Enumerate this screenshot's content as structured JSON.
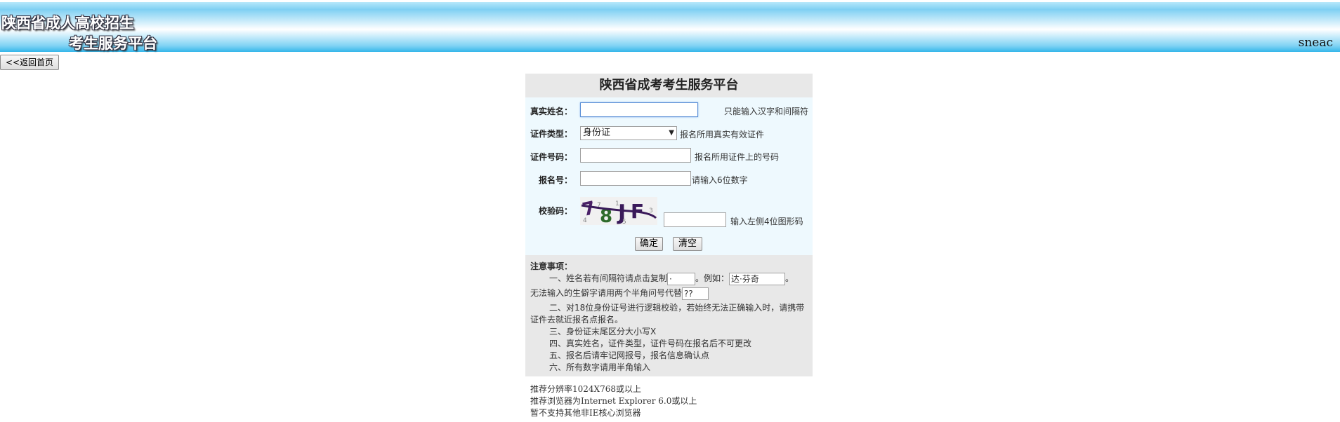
{
  "header": {
    "logo_line1": "陕西省成人高校招生",
    "logo_line2": "考生服务平台",
    "site_tag": "sneac"
  },
  "nav": {
    "back_label": "<<返回首页"
  },
  "panel": {
    "title": "陕西省成考考生服务平台",
    "fields": {
      "name": {
        "label": "真实姓名：",
        "value": "",
        "hint": "只能输入汉字和间隔符"
      },
      "id_type": {
        "label": "证件类型：",
        "selected": "身份证",
        "hint": "报名所用真实有效证件"
      },
      "id_number": {
        "label": "证件号码：",
        "value": "",
        "hint": "报名所用证件上的号码"
      },
      "reg_number": {
        "label": "报名号：",
        "value": "",
        "hint": "请输入6位数字"
      },
      "captcha": {
        "label": "校验码：",
        "value": "",
        "hint": "输入左侧4位图形码",
        "image_text": "78JF"
      }
    },
    "buttons": {
      "confirm": "确定",
      "clear": "清空"
    }
  },
  "notes": {
    "title": "注意事项：",
    "item1_pre": "一、姓名若有间隔符请点击复制",
    "item1_copy_value": "·",
    "item1_mid": "。例如：",
    "item1_example": "达·芬奇",
    "item1_post": "。",
    "item1_line2": "无法输入的生僻字请用两个半角问号代替",
    "item1_placeholder": "??",
    "item2_line1": "二、对18位身份证号进行逻辑校验，若始终无法正确输入时，请携带",
    "item2_line2": "证件去就近报名点报名。",
    "item3": "三、身份证末尾区分大小写X",
    "item4": "四、真实姓名，证件类型，证件号码在报名后不可更改",
    "item5": "五、报名后请牢记网报号，报名信息确认点",
    "item6": "六、所有数字请用半角输入"
  },
  "footer": {
    "line1": "推荐分辨率1024X768或以上",
    "line2": "推荐浏览器为Internet Explorer 6.0或以上",
    "line3": "暂不支持其他非IE核心浏览器"
  },
  "colors": {
    "banner_blue": "#35b6ea",
    "form_bg": "#eef9fe",
    "panel_gray": "#e8e8e8"
  }
}
